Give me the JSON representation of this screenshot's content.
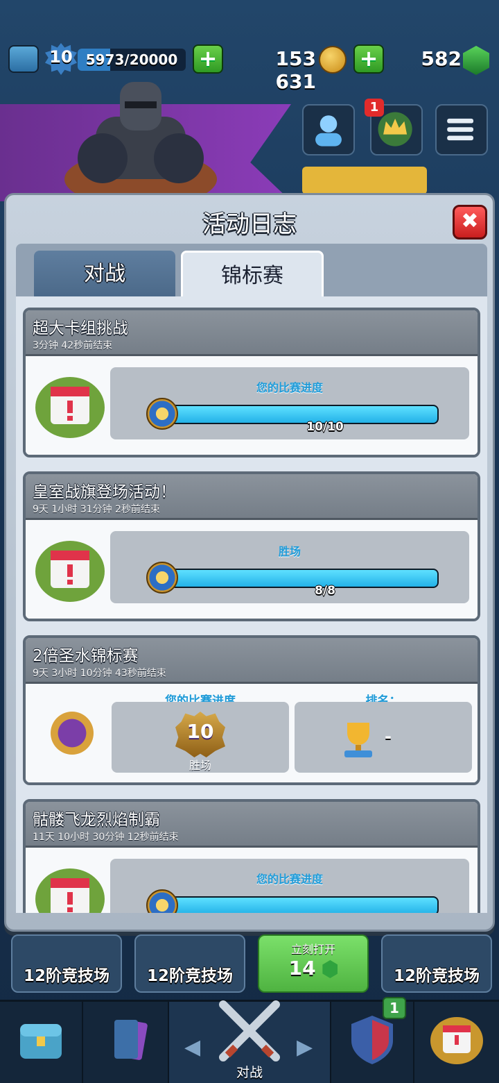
{
  "topbar": {
    "level": "10",
    "xp_text": "5973/20000",
    "xp_fraction": 0.3,
    "gold": "153 631",
    "gems": "582",
    "plus_symbol": "+"
  },
  "header_buttons": {
    "notification_count": "1"
  },
  "modal": {
    "title": "活动日志",
    "close_symbol": "✖",
    "tabs": [
      {
        "label": "对战",
        "active": false
      },
      {
        "label": "锦标赛",
        "active": true
      }
    ]
  },
  "events": [
    {
      "title": "超大卡组挑战",
      "subtitle": "3分钟 42秒前结束",
      "progress_label": "您的比赛进度",
      "progress_value": "10/10",
      "progress_fraction": 1.0
    },
    {
      "title": "皇室战旗登场活动！",
      "subtitle": "9天 1小时 31分钟 2秒前结束",
      "progress_label": "胜场",
      "progress_value": "8/8",
      "progress_fraction": 1.0
    },
    {
      "title": "2倍圣水锦标赛",
      "subtitle": "9天 3小时 10分钟 43秒前结束",
      "progress_label": "您的比赛进度",
      "wins_value": "10",
      "wins_caption": "胜场",
      "rank_label": "排名：",
      "rank_value": "-"
    },
    {
      "title": "骷髅飞龙烈焰制霸",
      "subtitle": "11天 10小时 30分钟 12秒前结束",
      "progress_label": "您的比赛进度",
      "progress_fraction": 1.0
    }
  ],
  "chests": [
    {
      "label": "12阶竞技场"
    },
    {
      "label": "12阶竞技场"
    },
    {
      "label": "立刻打开",
      "cost": "14"
    },
    {
      "label": "12阶竞技场"
    }
  ],
  "bottom_nav": {
    "battle_label": "对战",
    "clan_badge": "1"
  },
  "colors": {
    "progress_fill": "#23b2e8",
    "close_red": "#e12b2b",
    "green_plus": "#3fa34a"
  }
}
